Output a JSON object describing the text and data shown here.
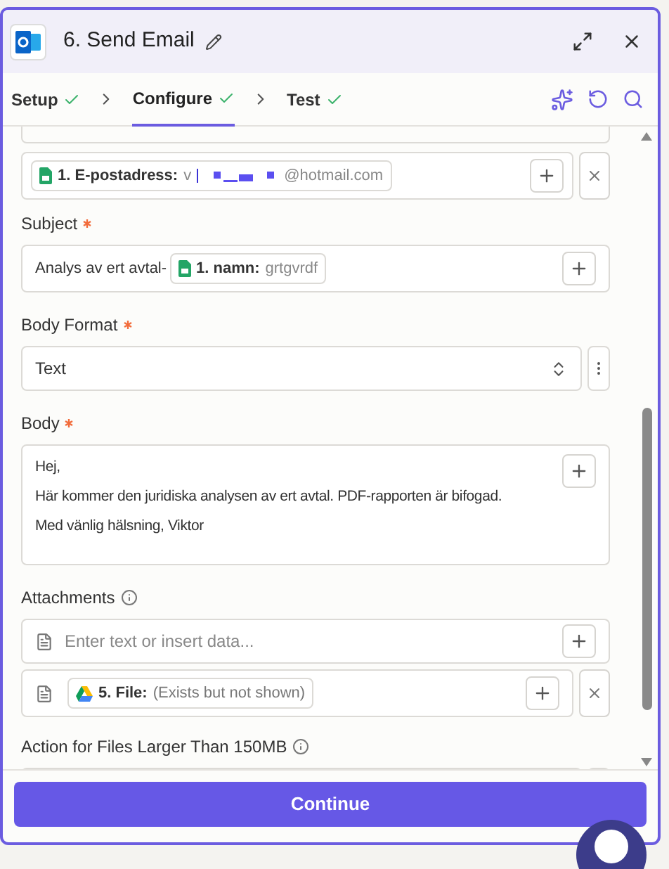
{
  "header": {
    "title": "6. Send Email"
  },
  "steps": [
    {
      "label": "Setup",
      "done": true,
      "selected": false
    },
    {
      "label": "Configure",
      "done": true,
      "selected": true
    },
    {
      "label": "Test",
      "done": true,
      "selected": false
    }
  ],
  "email_field": {
    "token_label": "1. E-postadress:",
    "value_start": "v",
    "value_end": "@hotmail.com"
  },
  "subject": {
    "label": "Subject",
    "required": true,
    "prefix": "Analys av ert avtal-",
    "token_label": "1. namn:",
    "token_value": "grtgvrdf"
  },
  "body_format": {
    "label": "Body Format",
    "required": true,
    "value": "Text"
  },
  "body": {
    "label": "Body",
    "required": true,
    "lines": [
      "Hej,",
      "Här kommer den juridiska analysen av ert avtal. PDF-rapporten är bifogad.",
      "Med vänlig hälsning, Viktor"
    ]
  },
  "attachments": {
    "label": "Attachments",
    "placeholder": "Enter text or insert data...",
    "token_label": "5. File:",
    "token_value": "(Exists but not shown)"
  },
  "large_files": {
    "label": "Action for Files Larger Than 150MB"
  },
  "continue_button": "Continue"
}
